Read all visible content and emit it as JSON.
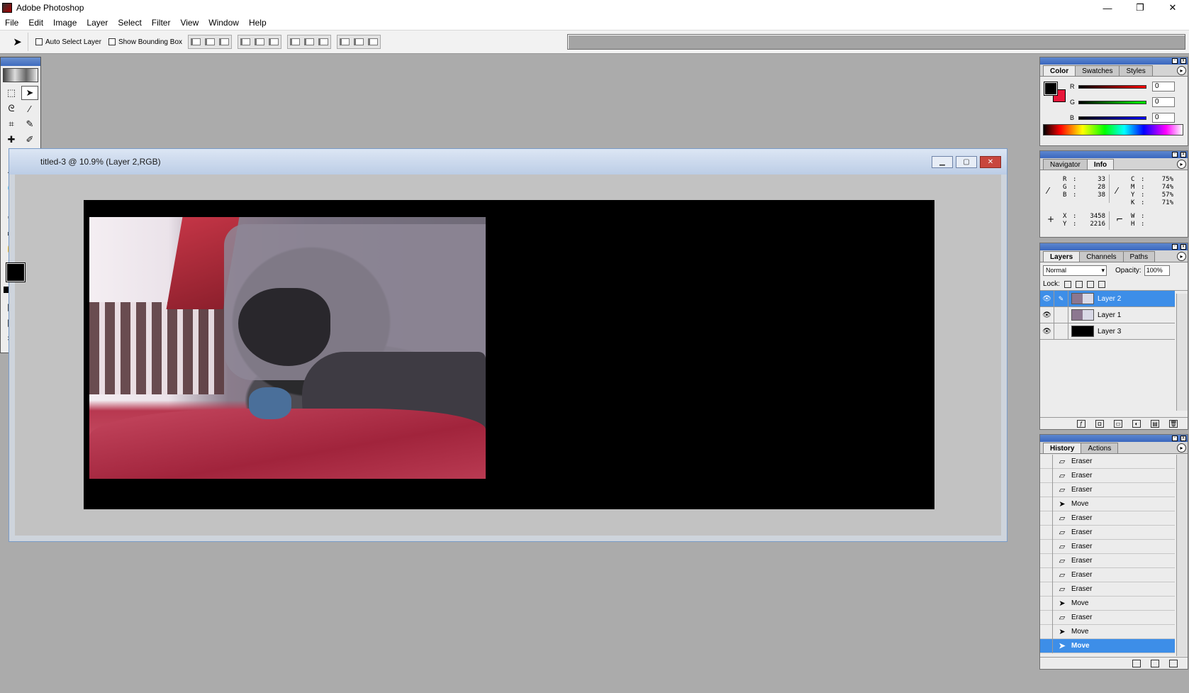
{
  "app": {
    "title": "Adobe Photoshop"
  },
  "window_controls": {
    "minimize": "—",
    "restore": "❐",
    "close": "✕"
  },
  "menu": [
    "File",
    "Edit",
    "Image",
    "Layer",
    "Select",
    "Filter",
    "View",
    "Window",
    "Help"
  ],
  "options": {
    "auto_select_layer": "Auto Select Layer",
    "show_bounding_box": "Show Bounding Box"
  },
  "document": {
    "title": "titled-3 @ 10.9% (Layer 2,RGB)"
  },
  "color_panel": {
    "tabs": [
      "Color",
      "Swatches",
      "Styles"
    ],
    "active_tab": "Color",
    "r_label": "R",
    "g_label": "G",
    "b_label": "B",
    "r": "0",
    "g": "0",
    "b": "0",
    "foreground": "#000000",
    "background": "#e8173a"
  },
  "info_panel": {
    "tabs": [
      "Navigator",
      "Info"
    ],
    "active_tab": "Info",
    "rgb": [
      [
        "R",
        ":",
        "33"
      ],
      [
        "G",
        ":",
        "28"
      ],
      [
        "B",
        ":",
        "38"
      ]
    ],
    "cmyk": [
      [
        "C",
        ":",
        "75%"
      ],
      [
        "M",
        ":",
        "74%"
      ],
      [
        "Y",
        ":",
        "57%"
      ],
      [
        "K",
        ":",
        "71%"
      ]
    ],
    "xy": [
      [
        "X",
        ":",
        "3458"
      ],
      [
        "Y",
        ":",
        "2216"
      ]
    ],
    "wh": [
      [
        "W",
        ":",
        ""
      ],
      [
        "H",
        ":",
        ""
      ]
    ]
  },
  "layers_panel": {
    "tabs": [
      "Layers",
      "Channels",
      "Paths"
    ],
    "active_tab": "Layers",
    "blend_mode": "Normal",
    "opacity_label": "Opacity:",
    "opacity": "100%",
    "lock_label": "Lock:",
    "layers": [
      {
        "name": "Layer 2",
        "selected": true
      },
      {
        "name": "Layer 1",
        "selected": false
      },
      {
        "name": "Layer 3",
        "selected": false
      }
    ]
  },
  "history_panel": {
    "tabs": [
      "History",
      "Actions"
    ],
    "active_tab": "History",
    "items": [
      "Eraser",
      "Eraser",
      "Eraser",
      "Move",
      "Eraser",
      "Eraser",
      "Eraser",
      "Eraser",
      "Eraser",
      "Eraser",
      "Move",
      "Eraser",
      "Move",
      "Move"
    ],
    "selected_index": 13
  },
  "tools": [
    "marquee-tool",
    "move-tool",
    "lasso-tool",
    "magic-wand-tool",
    "crop-tool",
    "slice-tool",
    "healing-brush-tool",
    "brush-tool",
    "clone-stamp-tool",
    "history-brush-tool",
    "eraser-tool",
    "paint-bucket-tool",
    "blur-tool",
    "burn-tool",
    "path-select-tool",
    "type-tool",
    "pen-tool",
    "ellipse-tool",
    "notes-tool",
    "eyedropper-tool",
    "hand-tool",
    "zoom-tool"
  ],
  "toolbox_colors": {
    "foreground": "#000000",
    "background": "#e8173a"
  },
  "accent": "#3d8ee8"
}
